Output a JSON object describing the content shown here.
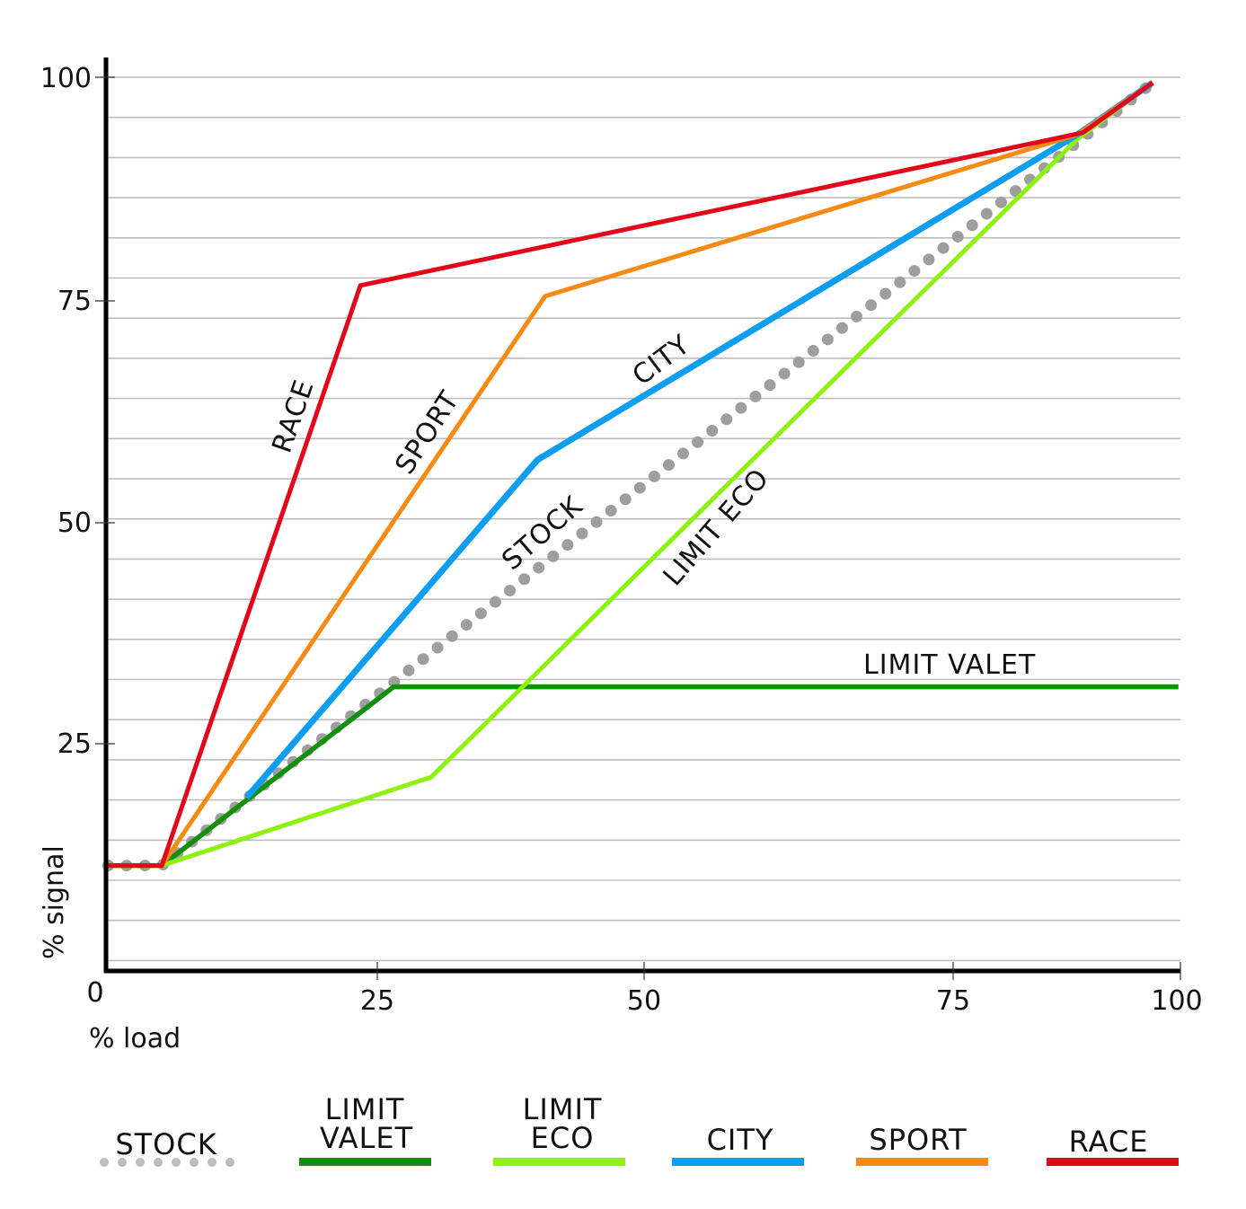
{
  "chart_data": {
    "type": "line",
    "title": "",
    "xlabel": "% load",
    "ylabel": "% signal",
    "xlim": [
      0,
      100
    ],
    "ylim": [
      0,
      100
    ],
    "x_ticks": [
      "0",
      "25",
      "50",
      "75",
      "100"
    ],
    "y_ticks": [
      "25",
      "50",
      "75",
      "100"
    ],
    "grid": true,
    "legend_position": "bottom",
    "series": [
      {
        "name": "STOCK",
        "legend_label": [
          "STOCK"
        ],
        "color": "#9e9e9e",
        "style": "dotted",
        "points": [
          [
            0.2,
            11.8
          ],
          [
            5.2,
            11.8
          ],
          [
            97.5,
            99.4
          ]
        ]
      },
      {
        "name": "LIMIT VALET",
        "legend_label": [
          "LIMIT",
          "VALET"
        ],
        "color": "#138f0b",
        "style": "solid",
        "points": [
          [
            0.2,
            11.8
          ],
          [
            5.2,
            11.8
          ],
          [
            26.8,
            31.8
          ],
          [
            99.9,
            31.8
          ]
        ]
      },
      {
        "name": "LIMIT ECO",
        "legend_label": [
          "LIMIT",
          "ECO"
        ],
        "color": "#8ef20f",
        "style": "solid",
        "points": [
          [
            0.2,
            11.8
          ],
          [
            5.2,
            11.8
          ],
          [
            30.3,
            21.7
          ],
          [
            90.5,
            93.1
          ],
          [
            97.5,
            99.4
          ]
        ]
      },
      {
        "name": "CITY",
        "legend_label": [
          "CITY"
        ],
        "color": "#0d9ef2",
        "style": "solid",
        "points": [
          [
            13.1,
            19.4
          ],
          [
            40.2,
            57.2
          ],
          [
            90.5,
            93.6
          ],
          [
            97.5,
            99.4
          ]
        ]
      },
      {
        "name": "SPORT",
        "legend_label": [
          "SPORT"
        ],
        "color": "#f78a12",
        "style": "solid",
        "points": [
          [
            0.2,
            11.8
          ],
          [
            5.2,
            11.8
          ],
          [
            40.9,
            75.5
          ],
          [
            90.5,
            93.6
          ],
          [
            97.5,
            99.4
          ]
        ]
      },
      {
        "name": "RACE",
        "legend_label": [
          "RACE"
        ],
        "color": "#e3071a",
        "style": "solid",
        "points": [
          [
            0.2,
            11.8
          ],
          [
            5.2,
            11.8
          ],
          [
            23.7,
            76.7
          ],
          [
            91.0,
            93.8
          ],
          [
            97.5,
            99.4
          ]
        ]
      }
    ],
    "annotations": [
      {
        "text": "RACE",
        "series": "RACE"
      },
      {
        "text": "SPORT",
        "series": "SPORT"
      },
      {
        "text": "CITY",
        "series": "CITY"
      },
      {
        "text": "STOCK",
        "series": "STOCK"
      },
      {
        "text": "LIMIT ECO",
        "series": "LIMIT ECO"
      },
      {
        "text": "LIMIT VALET",
        "series": "LIMIT VALET"
      }
    ]
  }
}
